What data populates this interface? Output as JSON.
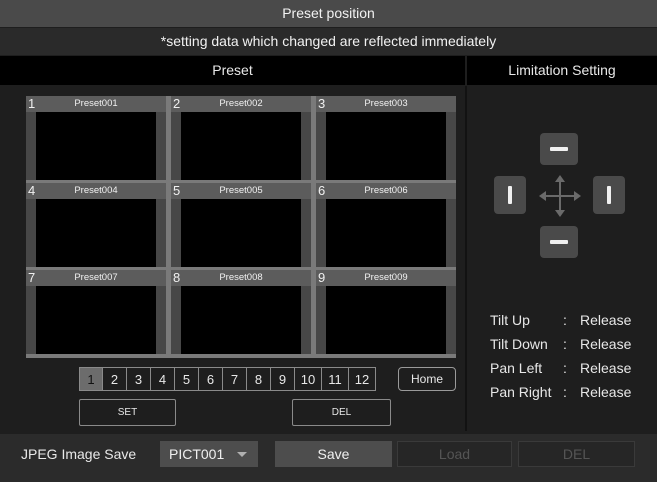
{
  "window": {
    "title": "Preset position",
    "notice": "*setting data which changed are reflected immediately"
  },
  "headers": {
    "preset": "Preset",
    "limitation": "Limitation Setting"
  },
  "presets": [
    {
      "num": "1",
      "name": "Preset001"
    },
    {
      "num": "2",
      "name": "Preset002"
    },
    {
      "num": "3",
      "name": "Preset003"
    },
    {
      "num": "4",
      "name": "Preset004"
    },
    {
      "num": "5",
      "name": "Preset005"
    },
    {
      "num": "6",
      "name": "Preset006"
    },
    {
      "num": "7",
      "name": "Preset007"
    },
    {
      "num": "8",
      "name": "Preset008"
    },
    {
      "num": "9",
      "name": "Preset009"
    }
  ],
  "pagination": {
    "pages": [
      "1",
      "2",
      "3",
      "4",
      "5",
      "6",
      "7",
      "8",
      "9",
      "10",
      "11",
      "12"
    ],
    "selected": "1",
    "home_label": "Home"
  },
  "actions": {
    "set_label": "SET",
    "del_label": "DEL"
  },
  "limitation": {
    "tilt_up": {
      "label": "Tilt Up",
      "value": "Release"
    },
    "tilt_down": {
      "label": "Tilt Down",
      "value": "Release"
    },
    "pan_left": {
      "label": "Pan Left",
      "value": "Release"
    },
    "pan_right": {
      "label": "Pan Right",
      "value": "Release"
    },
    "separator": ":"
  },
  "jpeg": {
    "label": "JPEG Image Save",
    "selected": "PICT001",
    "save_label": "Save",
    "load_label": "Load",
    "del_label": "DEL"
  },
  "icons": {
    "limit_up": "minus-icon",
    "limit_down": "minus-icon",
    "limit_left": "bar-icon",
    "limit_right": "bar-icon",
    "center": "move-arrows-icon",
    "dropdown": "caret-down-icon"
  },
  "colors": {
    "background": "#1e1e1e",
    "header": "#000000",
    "title_bar": "#4a4a4a",
    "button": "#4d4d4d",
    "disabled_text": "#555555"
  }
}
